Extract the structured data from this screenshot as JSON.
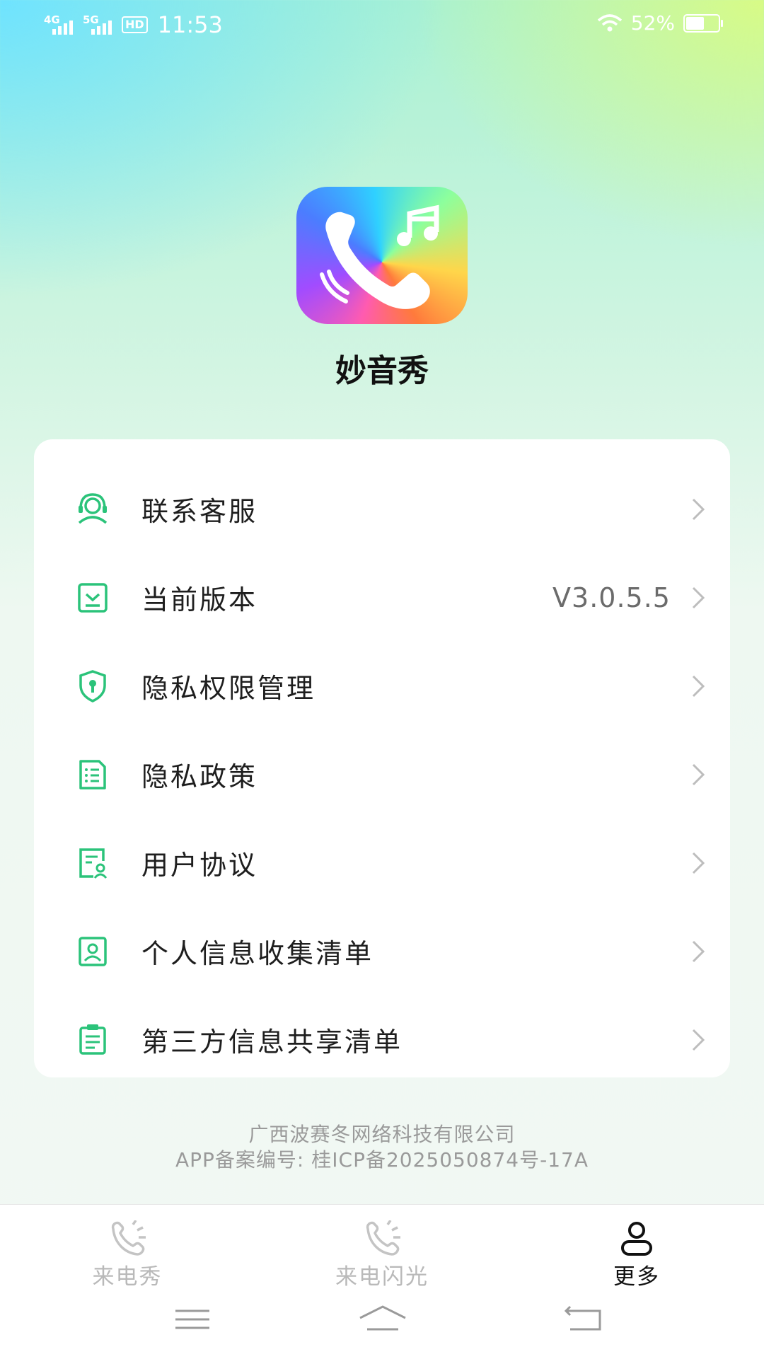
{
  "status_bar": {
    "signal1": "4G",
    "signal2": "5G",
    "hd": "HD",
    "time": "11:53",
    "battery": "52%",
    "battery_level": 0.52
  },
  "app": {
    "name": "妙音秀",
    "icon": "phone-music-icon"
  },
  "menu": [
    {
      "label": "联系客服",
      "icon": "headset-icon",
      "value": ""
    },
    {
      "label": "当前版本",
      "icon": "version-download-icon",
      "value": "V3.0.5.5"
    },
    {
      "label": "隐私权限管理",
      "icon": "shield-key-icon",
      "value": ""
    },
    {
      "label": "隐私政策",
      "icon": "document-list-icon",
      "value": ""
    },
    {
      "label": "用户协议",
      "icon": "user-agreement-icon",
      "value": ""
    },
    {
      "label": "个人信息收集清单",
      "icon": "profile-card-icon",
      "value": ""
    },
    {
      "label": "第三方信息共享清单",
      "icon": "clipboard-list-icon",
      "value": ""
    }
  ],
  "footer": {
    "company": "广西波赛冬网络科技有限公司",
    "icp": "APP备案编号:   桂ICP备2025050874号-17A"
  },
  "tabs": [
    {
      "label": "来电秀",
      "icon": "ringing-phone-icon",
      "active": false
    },
    {
      "label": "来电闪光",
      "icon": "flash-phone-icon",
      "active": false
    },
    {
      "label": "更多",
      "icon": "person-icon",
      "active": true
    }
  ],
  "colors": {
    "accent_green": "#2bc37a",
    "text_primary": "#1e1e1e",
    "text_secondary": "#9a9a9a"
  }
}
